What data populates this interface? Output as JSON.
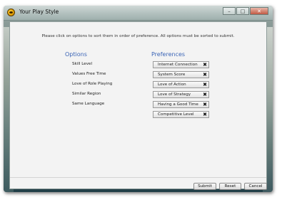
{
  "window": {
    "title": "Your Play Style",
    "controls": {
      "minimize": "–",
      "maximize": "□",
      "close": "✕"
    }
  },
  "instruction": "Please click on options to sort them in order of preference. All options must be sorted to submit.",
  "options": {
    "header": "Options",
    "items": [
      "Skill Level",
      "Values Free Time",
      "Love of Role Playing",
      "Similar Region",
      "Same Language"
    ]
  },
  "preferences": {
    "header": "Preferences",
    "items": [
      "Internet Connection",
      "System Score",
      "Love of Action",
      "Love of Strategy",
      "Having a Good Time",
      "Competitive Level"
    ],
    "remove_glyph": "✖"
  },
  "buttons": {
    "submit": "Submit",
    "reset": "Reset",
    "cancel": "Cancel"
  },
  "colors": {
    "header_blue": "#3a64b6"
  }
}
